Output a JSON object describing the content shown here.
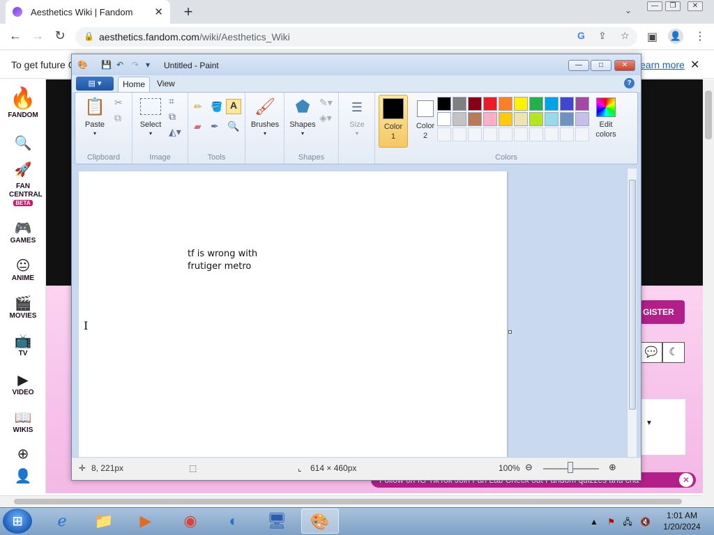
{
  "browser": {
    "tab_title": "Aesthetics Wiki | Fandom",
    "new_tab": "+",
    "url_host": "aesthetics.fandom.com",
    "url_path": "/wiki/Aesthetics_Wiki"
  },
  "page": {
    "banner_text": "To get future G",
    "learn_more": "earn more",
    "rail": [
      {
        "icon": "🔥",
        "label": "FANDOM"
      },
      {
        "icon": "🔍",
        "label": ""
      },
      {
        "icon": "🚀",
        "label": "FAN CENTRAL"
      },
      {
        "icon": "🎮",
        "label": "GAMES"
      },
      {
        "icon": "😐",
        "label": "ANIME"
      },
      {
        "icon": "🎬",
        "label": "MOVIES"
      },
      {
        "icon": "📺",
        "label": "TV"
      },
      {
        "icon": "▶",
        "label": "VIDEO"
      },
      {
        "icon": "📖",
        "label": "WIKIS"
      },
      {
        "icon": "⊕",
        "label": ""
      },
      {
        "icon": "👤",
        "label": ""
      }
    ],
    "beta": "BETA",
    "register": "GISTER",
    "follow_bar": "Follow on IG   TikTok   Join Fan Lab   Check out Fandom quizzes and cha"
  },
  "paint": {
    "title": "Untitled - Paint",
    "tabs": {
      "home": "Home",
      "view": "View"
    },
    "groups": {
      "clipboard": "Clipboard",
      "image": "Image",
      "tools": "Tools",
      "shapes": "Shapes",
      "colors": "Colors"
    },
    "buttons": {
      "paste": "Paste",
      "select": "Select",
      "brushes": "Brushes",
      "shapes": "Shapes",
      "size": "Size",
      "color1": "Color\n1",
      "color2": "Color\n2",
      "edit_colors": "Edit\ncolors"
    },
    "palette_row1": [
      "#000000",
      "#7f7f7f",
      "#880015",
      "#ed1c24",
      "#ff7f27",
      "#fff200",
      "#22b14c",
      "#00a2e8",
      "#3f48cc",
      "#a349a4"
    ],
    "palette_row2": [
      "#ffffff",
      "#c3c3c3",
      "#b97a57",
      "#ffaec9",
      "#ffc90e",
      "#efe4b0",
      "#b5e61d",
      "#99d9ea",
      "#7092be",
      "#c8bfe7"
    ],
    "canvas_text": "tf is wrong with\nfrutiger metro",
    "status": {
      "cursor_pos": "8, 221px",
      "canvas_size": "614 × 460px",
      "zoom": "100%"
    }
  },
  "taskbar": {
    "time": "1:01 AM",
    "date": "1/20/2024"
  }
}
